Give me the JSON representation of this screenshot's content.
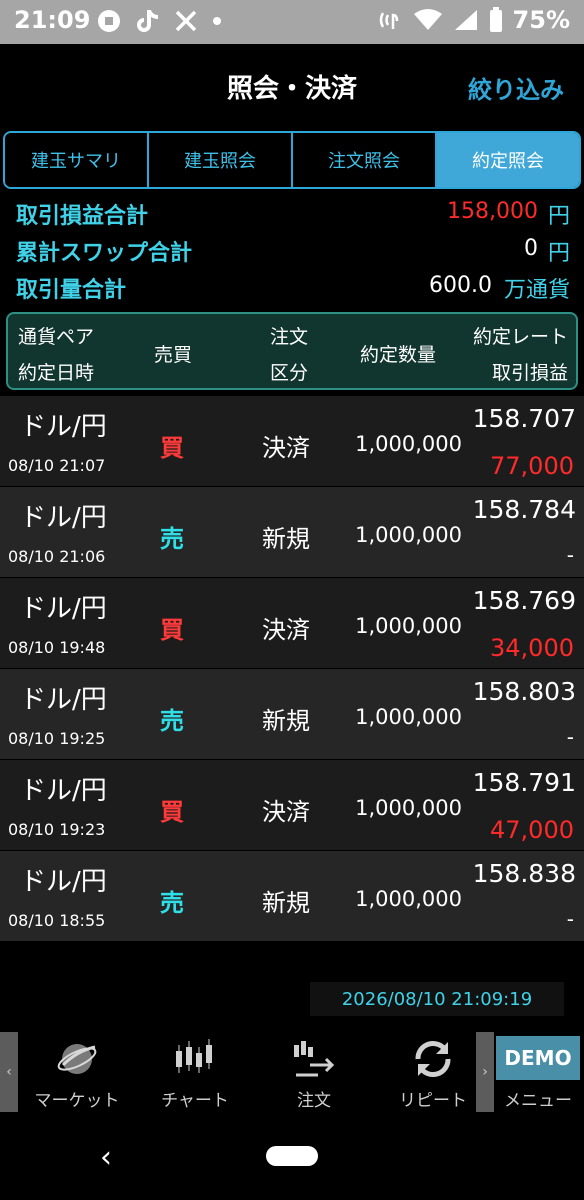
{
  "status_bar": {
    "time": "21:09",
    "battery": "75%",
    "icons": [
      "notification-app-icon",
      "tiktok-icon",
      "x-icon",
      "dot-icon",
      "nfc-icon",
      "wifi-icon",
      "signal-icon",
      "battery-icon"
    ]
  },
  "header": {
    "title": "照会・決済",
    "filter_label": "絞り込み"
  },
  "tabs": [
    {
      "label": "建玉サマリ",
      "active": false
    },
    {
      "label": "建玉照会",
      "active": false
    },
    {
      "label": "注文照会",
      "active": false
    },
    {
      "label": "約定照会",
      "active": true
    }
  ],
  "summary": {
    "pl_label": "取引損益合計",
    "pl_value": "158,000",
    "pl_unit": "円",
    "swap_label": "累計スワップ合計",
    "swap_value": "0",
    "swap_unit": "円",
    "volume_label": "取引量合計",
    "volume_value": "600.0",
    "volume_unit": "万通貨"
  },
  "columns": {
    "pair": "通貨ペア",
    "datetime": "約定日時",
    "side": "売買",
    "order_type_1": "注文",
    "order_type_2": "区分",
    "quantity": "約定数量",
    "rate": "約定レート",
    "pl": "取引損益"
  },
  "rows": [
    {
      "pair": "ドル/円",
      "datetime": "08/10 21:07",
      "side": "買",
      "side_type": "buy",
      "order_type": "決済",
      "quantity": "1,000,000",
      "rate": "158.707",
      "pl": "77,000"
    },
    {
      "pair": "ドル/円",
      "datetime": "08/10 21:06",
      "side": "売",
      "side_type": "sell",
      "order_type": "新規",
      "quantity": "1,000,000",
      "rate": "158.784",
      "pl": "-"
    },
    {
      "pair": "ドル/円",
      "datetime": "08/10 19:48",
      "side": "買",
      "side_type": "buy",
      "order_type": "決済",
      "quantity": "1,000,000",
      "rate": "158.769",
      "pl": "34,000"
    },
    {
      "pair": "ドル/円",
      "datetime": "08/10 19:25",
      "side": "売",
      "side_type": "sell",
      "order_type": "新規",
      "quantity": "1,000,000",
      "rate": "158.803",
      "pl": "-"
    },
    {
      "pair": "ドル/円",
      "datetime": "08/10 19:23",
      "side": "買",
      "side_type": "buy",
      "order_type": "決済",
      "quantity": "1,000,000",
      "rate": "158.791",
      "pl": "47,000"
    },
    {
      "pair": "ドル/円",
      "datetime": "08/10 18:55",
      "side": "売",
      "side_type": "sell",
      "order_type": "新規",
      "quantity": "1,000,000",
      "rate": "158.838",
      "pl": "-"
    }
  ],
  "timestamp": "2026/08/10 21:09:19",
  "bottom_nav": {
    "left_arrow": "‹",
    "right_arrow": "›",
    "market": "マーケット",
    "chart": "チャート",
    "order": "注文",
    "repeat": "リピート",
    "demo": "DEMO",
    "menu": "メニュー"
  },
  "system_nav": {
    "back": "‹"
  },
  "colors": {
    "accent": "#2fa6d8",
    "cyan_label": "#3fd2e8",
    "profit_red": "#ff2a2a",
    "buy_red": "#ff3a3a",
    "sell_cyan": "#2fe0e8",
    "header_bg": "#11352f",
    "demo_bg": "#4a8fa8"
  }
}
